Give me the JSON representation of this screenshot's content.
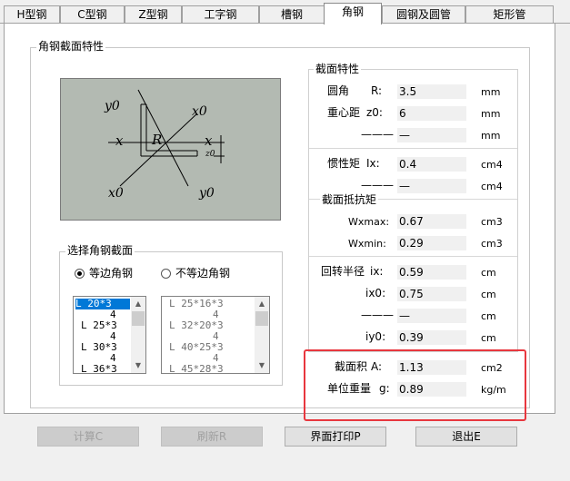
{
  "tabs": [
    {
      "label": "H型钢",
      "active": false
    },
    {
      "label": "C型钢",
      "active": false
    },
    {
      "label": "Z型钢",
      "active": false
    },
    {
      "label": "工字钢",
      "active": false
    },
    {
      "label": "槽钢",
      "active": false
    },
    {
      "label": "角钢",
      "active": true
    },
    {
      "label": "圆钢及圆管",
      "active": false
    },
    {
      "label": "矩形管",
      "active": false
    }
  ],
  "section_group_title": "角钢截面特性",
  "diagram": {
    "y0_top_left": "y0",
    "x0_top_right": "x0",
    "x_left": "x",
    "x_right": "x",
    "R": "R",
    "z_dim": "z0",
    "x0_bottom_left": "x0",
    "y0_bottom_right": "y0"
  },
  "select_group": {
    "title": "选择角钢截面",
    "equal_label": "等边角钢",
    "unequal_label": "不等边角钢",
    "equal_list": [
      "L 20*3",
      "4",
      "L 25*3",
      "4",
      "L 30*3",
      "4",
      "L 36*3"
    ],
    "unequal_list": [
      "L 25*16*3",
      "4",
      "L 32*20*3",
      "4",
      "L 40*25*3",
      "4",
      "L 45*28*3"
    ]
  },
  "props_title": "截面特性",
  "props": {
    "r": {
      "label": "圆角",
      "sym": "R:",
      "value": "3.5",
      "unit": "mm"
    },
    "z0": {
      "label": "重心距",
      "sym": "z0:",
      "value": "6",
      "unit": "mm"
    },
    "blank1": {
      "sym": "———",
      "value": "—",
      "unit": "mm"
    },
    "ix": {
      "label": "惯性矩",
      "sym": "Ix:",
      "value": "0.4",
      "unit": "cm4"
    },
    "blank2": {
      "sym": "———",
      "value": "—",
      "unit": "cm4"
    },
    "resist_title": "截面抵抗矩",
    "wxmax": {
      "sym": "Wxmax:",
      "value": "0.67",
      "unit": "cm3"
    },
    "wxmin": {
      "sym": "Wxmin:",
      "value": "0.29",
      "unit": "cm3"
    },
    "radius": {
      "label": "回转半径",
      "sym": "ix:",
      "value": "0.59",
      "unit": "cm"
    },
    "ix0": {
      "sym": "ix0:",
      "value": "0.75",
      "unit": "cm"
    },
    "blank3": {
      "sym": "———",
      "value": "—",
      "unit": "cm"
    },
    "iy0": {
      "sym": "iy0:",
      "value": "0.39",
      "unit": "cm"
    },
    "area": {
      "label": "截面积",
      "sym": "A:",
      "value": "1.13",
      "unit": "cm2"
    },
    "weight": {
      "label": "单位重量",
      "sym": "g:",
      "value": "0.89",
      "unit": "kg/m"
    }
  },
  "buttons": {
    "calc": "计算C",
    "refresh": "刷新R",
    "print": "界面打印P",
    "exit": "退出E"
  },
  "colors": {
    "highlight_box": "#e8373e",
    "selection": "#0078d7",
    "diagram_bg": "#b3bab2"
  }
}
